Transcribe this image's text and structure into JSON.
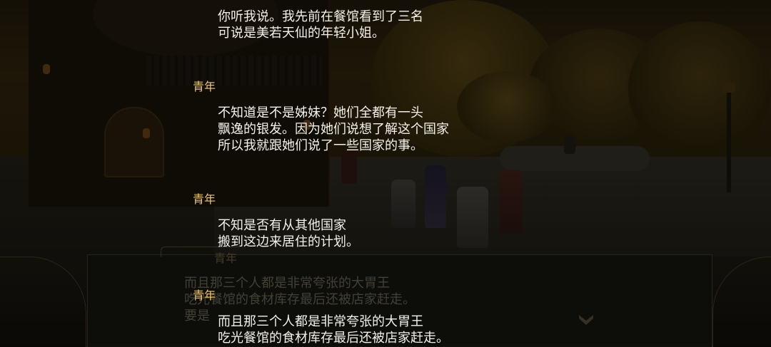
{
  "background_dialog": {
    "speaker": "青年",
    "text": "而且那三个人都是非常夸张的大胃王\n吃光餐馆的食材库存最后还被店家赶走。\n要是"
  },
  "log": {
    "entries": [
      {
        "speaker": "",
        "text": "你听我说。我先前在餐馆看到了三名\n可说是美若天仙的年轻小姐。"
      },
      {
        "speaker": "青年",
        "text": "不知道是不是姊妹？她们全都有一头\n飘逸的银发。因为她们说想了解这个国家\n所以我就跟她们说了一些国家的事。"
      },
      {
        "speaker": "青年",
        "text": "不知是否有从其他国家\n搬到这边来居住的计划。"
      },
      {
        "speaker": "青年",
        "text": "而且那三个人都是非常夸张的大胃王\n吃光餐馆的食材库存最后还被店家赶走。"
      }
    ]
  },
  "colors": {
    "speaker_name": "#f2c960",
    "log_text": "#f3f1ea"
  }
}
